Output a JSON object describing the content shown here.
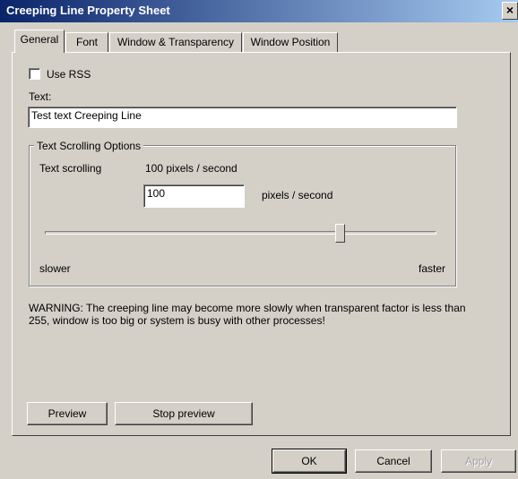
{
  "window": {
    "title": "Creeping Line Property Sheet",
    "close_glyph": "×"
  },
  "tabs": [
    "General",
    "Font",
    "Window & Transparency",
    "Window Position"
  ],
  "general": {
    "use_rss_label": "Use RSS",
    "use_rss_checked": false,
    "text_label": "Text:",
    "text_value": "Test text Creeping Line",
    "scrolling_group_title": "Text Scrolling Options",
    "scrolling_label": "Text scrolling",
    "scrolling_display": "100 pixels / second",
    "speed_value": "100",
    "speed_unit": "pixels / second",
    "slider_position_fraction": 0.76,
    "slower_label": "slower",
    "faster_label": "faster",
    "warning_text": "WARNING: The creeping line may become more slowly when transparent factor is less than 255, window is too big or system is busy with other processes!",
    "preview_button": "Preview",
    "stop_preview_button": "Stop preview"
  },
  "footer": {
    "ok": "OK",
    "cancel": "Cancel",
    "apply": "Apply"
  }
}
